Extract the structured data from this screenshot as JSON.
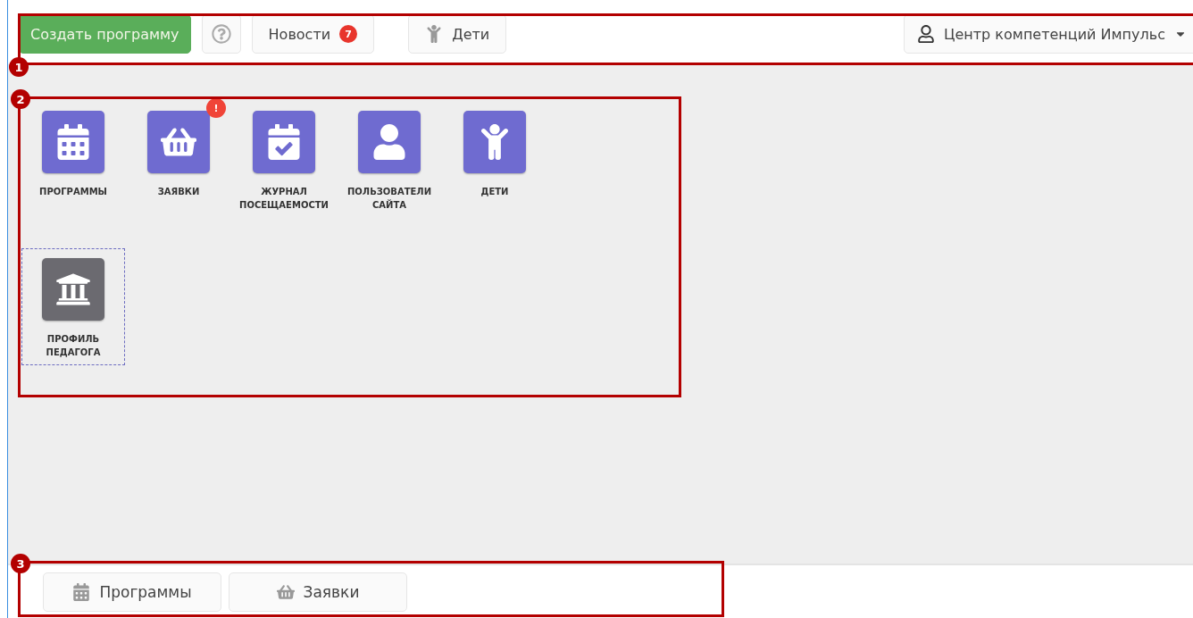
{
  "toolbar": {
    "create_button": "Создать программу",
    "news": {
      "label": "Новости",
      "badge": "7"
    },
    "children_button": "Дети",
    "account": "Центр компетенций Импульс"
  },
  "tiles": [
    {
      "label": "ПРОГРАММЫ",
      "kind": "calendar",
      "color": "#6f6bd0",
      "selected": false
    },
    {
      "label": "ЗАЯВКИ",
      "kind": "basket",
      "color": "#6f6bd0",
      "selected": false,
      "badge": "!"
    },
    {
      "label": "ЖУРНАЛ\nПОСЕЩАЕМОСТИ",
      "kind": "calendar-check",
      "color": "#6f6bd0",
      "selected": false
    },
    {
      "label": "ПОЛЬЗОВАТЕЛИ\nСАЙТА",
      "kind": "user",
      "color": "#6f6bd0",
      "selected": false
    },
    {
      "label": "ДЕТИ",
      "kind": "child",
      "color": "#6f6bd0",
      "selected": false
    },
    {
      "label": "ПРОФИЛЬ\nПЕДАГОГА",
      "kind": "building",
      "color": "#6b6a70",
      "selected": true
    }
  ],
  "footer_tabs": [
    {
      "label": "Программы",
      "kind": "calendar"
    },
    {
      "label": "Заявки",
      "kind": "basket"
    }
  ],
  "callouts": [
    {
      "number": "1"
    },
    {
      "number": "2"
    },
    {
      "number": "3"
    }
  ]
}
